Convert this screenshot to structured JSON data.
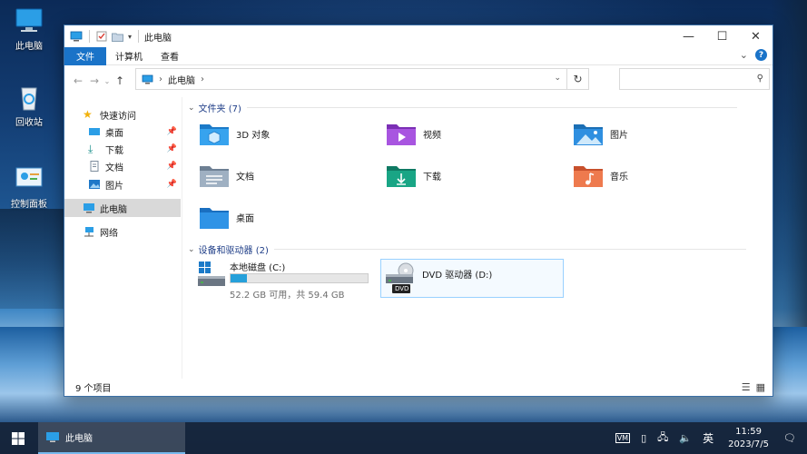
{
  "desktop": {
    "icons": [
      {
        "label": "此电脑",
        "icon": "computer-icon"
      },
      {
        "label": "回收站",
        "icon": "recycle-bin-icon"
      },
      {
        "label": "控制面板",
        "icon": "control-panel-icon"
      }
    ]
  },
  "window": {
    "title": "此电脑",
    "controls": {
      "minimize": "—",
      "maximize": "☐",
      "close": "✕"
    }
  },
  "ribbon": {
    "tabs": [
      "文件",
      "计算机",
      "查看"
    ],
    "active_tab": "文件",
    "expand_glyph": "⌄",
    "help": "?"
  },
  "address": {
    "path": "此电脑",
    "separator": "›",
    "dropdown": "⌄",
    "refresh": "↻",
    "search_placeholder": ""
  },
  "sidebar": {
    "items": [
      {
        "label": "快速访问",
        "icon": "star-icon",
        "pinned": false
      },
      {
        "label": "桌面",
        "icon": "desktop-icon",
        "pinned": true
      },
      {
        "label": "下载",
        "icon": "download-icon",
        "pinned": true
      },
      {
        "label": "文档",
        "icon": "document-icon",
        "pinned": true
      },
      {
        "label": "图片",
        "icon": "picture-icon",
        "pinned": true
      },
      {
        "label": "此电脑",
        "icon": "computer-icon",
        "selected": true
      },
      {
        "label": "网络",
        "icon": "network-icon"
      }
    ]
  },
  "content": {
    "folders_header": "文件夹 (7)",
    "folders": [
      {
        "label": "3D 对象",
        "icon": "3d-objects-folder-icon"
      },
      {
        "label": "视频",
        "icon": "videos-folder-icon"
      },
      {
        "label": "图片",
        "icon": "pictures-folder-icon"
      },
      {
        "label": "文档",
        "icon": "documents-folder-icon"
      },
      {
        "label": "下载",
        "icon": "downloads-folder-icon"
      },
      {
        "label": "音乐",
        "icon": "music-folder-icon"
      },
      {
        "label": "桌面",
        "icon": "desktop-folder-icon"
      }
    ],
    "devices_header": "设备和驱动器 (2)",
    "drives": [
      {
        "label": "本地磁盘 (C:)",
        "detail": "52.2 GB 可用，共 59.4 GB",
        "used_fraction": 0.12
      },
      {
        "label": "DVD 驱动器 (D:)",
        "badge": "DVD"
      }
    ]
  },
  "status": {
    "count": "9 个项目"
  },
  "taskbar": {
    "app_label": "此电脑",
    "ime": "英",
    "time": "11:59",
    "date": "2023/7/5"
  },
  "colors": {
    "accent": "#1a73c8",
    "header_text": "#1e3d87",
    "bar_fill": "#26a0da"
  }
}
